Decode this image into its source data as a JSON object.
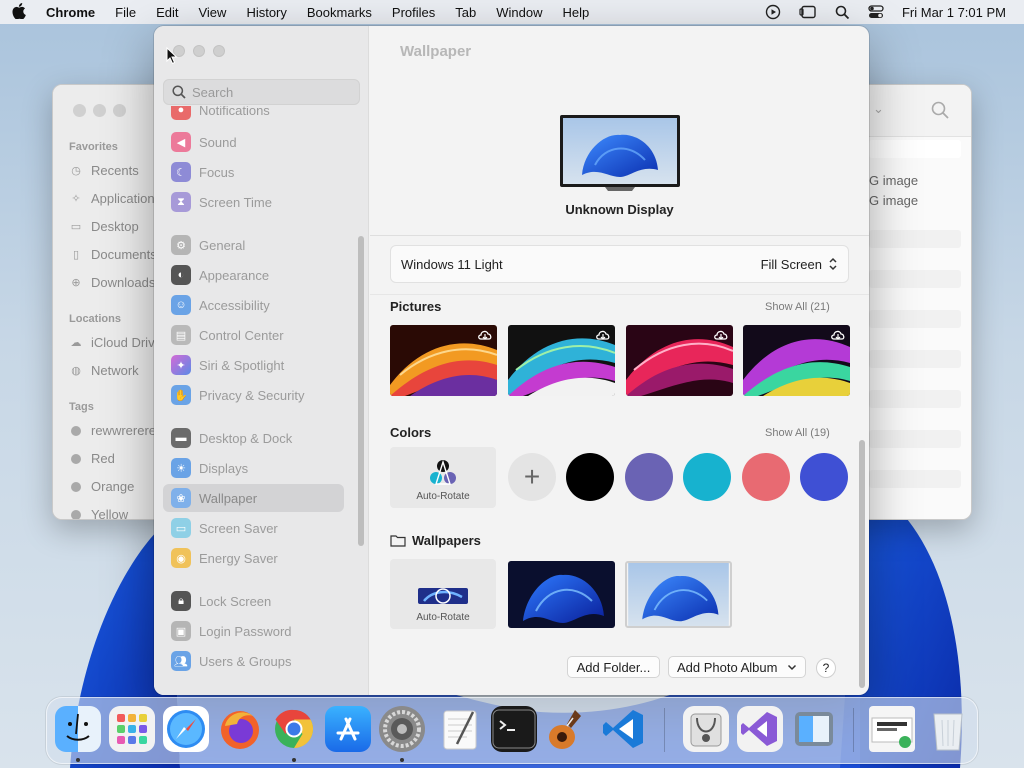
{
  "menubar": {
    "app": "Chrome",
    "items": [
      "File",
      "Edit",
      "View",
      "History",
      "Bookmarks",
      "Profiles",
      "Tab",
      "Window",
      "Help"
    ],
    "clock": "Fri Mar 1  7:01 PM"
  },
  "finder": {
    "favorites_label": "Favorites",
    "favorites": [
      "Recents",
      "Applications",
      "Desktop",
      "Documents",
      "Downloads"
    ],
    "locations_label": "Locations",
    "locations": [
      "iCloud Drive",
      "Network"
    ],
    "tags_label": "Tags",
    "tags": [
      "rewwrererer",
      "Red",
      "Orange",
      "Yellow"
    ],
    "files": [
      "G image",
      "G image"
    ]
  },
  "settings": {
    "search_placeholder": "Search",
    "sidebar": [
      "Notifications",
      "Sound",
      "Focus",
      "Screen Time",
      "General",
      "Appearance",
      "Accessibility",
      "Control Center",
      "Siri & Spotlight",
      "Privacy & Security",
      "Desktop & Dock",
      "Displays",
      "Wallpaper",
      "Screen Saver",
      "Energy Saver",
      "Lock Screen",
      "Login Password",
      "Users & Groups"
    ],
    "selected_item": "Wallpaper",
    "content": {
      "title": "Wallpaper",
      "display_name": "Unknown Display",
      "current_wallpaper": "Windows 11 Light",
      "fit_mode": "Fill Screen",
      "pictures_label": "Pictures",
      "pictures_show_all": "Show All (21)",
      "colors_label": "Colors",
      "colors_show_all": "Show All (19)",
      "auto_rotate_label": "Auto-Rotate",
      "colors": [
        "#000000",
        "#6a63b4",
        "#17b2cf",
        "#e86a72",
        "#3f50d4"
      ],
      "wallpapers_label": "Wallpapers",
      "auto_rotate_label_2": "Auto-Rotate",
      "add_folder": "Add Folder...",
      "add_photo_album": "Add Photo Album",
      "help": "?"
    }
  },
  "dock": {
    "apps": [
      "Finder",
      "Launchpad",
      "Safari",
      "Firefox",
      "Chrome",
      "App Store",
      "System Settings",
      "TextEdit",
      "Terminal",
      "GarageBand",
      "Visual Studio Code",
      "Disk Utility",
      "Visual Studio",
      "Migration Assistant",
      "Screenshot",
      "Trash"
    ]
  }
}
